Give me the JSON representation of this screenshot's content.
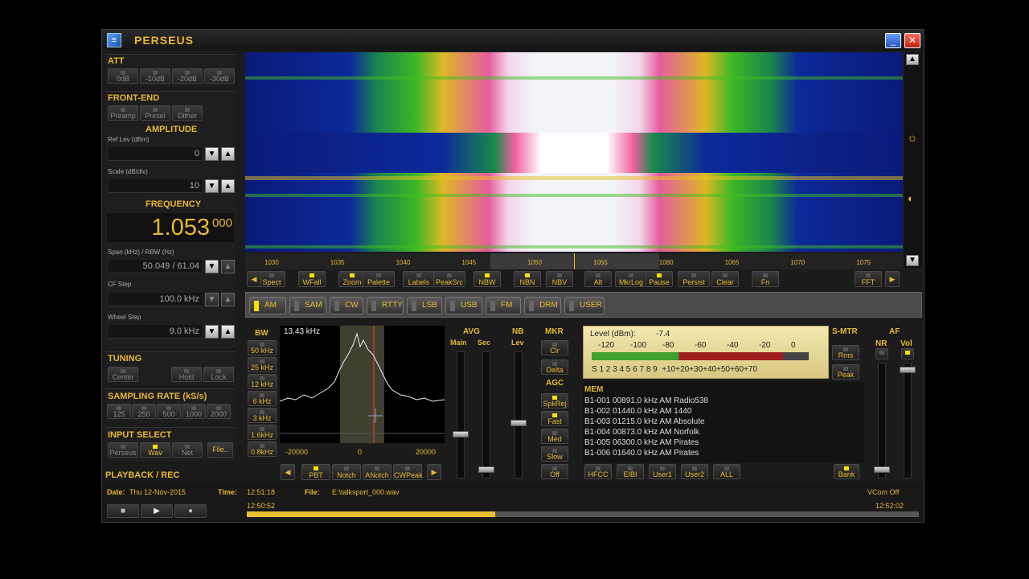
{
  "window": {
    "title": "PERSEUS",
    "minimize_label": "_",
    "close_label": "✕",
    "app_icon": "perseus-icon"
  },
  "att": {
    "title": "ATT",
    "buttons": [
      {
        "label": "0dB",
        "on": false
      },
      {
        "label": "-10dB",
        "on": false
      },
      {
        "label": "-20dB",
        "on": false
      },
      {
        "label": "-30dB",
        "on": false
      }
    ]
  },
  "frontend": {
    "title": "FRONT-END",
    "buttons": [
      {
        "label": "Preamp",
        "on": false
      },
      {
        "label": "Presel",
        "on": false
      },
      {
        "label": "Dither",
        "on": false
      }
    ]
  },
  "amplitude": {
    "title": "AMPLITUDE",
    "ref_label": "Ref Lev (dBm)",
    "ref_value": "0",
    "scale_label": "Scale (dB/div)",
    "scale_value": "10"
  },
  "frequency": {
    "title": "FREQUENCY",
    "main": "1.053",
    "fine": "000",
    "span_label": "Span (kHz) / RBW (Hz)",
    "span_value": "50.049 / 61.04",
    "cfstep_label": "CF Step",
    "cfstep_value": "100.0 kHz",
    "wheel_label": "Wheel Step",
    "wheel_value": "9.0 kHz"
  },
  "tuning": {
    "title": "TUNING",
    "buttons": [
      {
        "label": "Center",
        "on": false
      },
      {
        "label": "Hold",
        "on": false
      },
      {
        "label": "Lock",
        "on": false
      }
    ]
  },
  "sampling": {
    "title": "SAMPLING RATE (kS/s)",
    "buttons": [
      {
        "label": "125",
        "on": false
      },
      {
        "label": "250",
        "on": false
      },
      {
        "label": "500",
        "on": false
      },
      {
        "label": "1000",
        "on": false
      },
      {
        "label": "2000",
        "on": false
      }
    ]
  },
  "input": {
    "title": "INPUT SELECT",
    "buttons": [
      {
        "label": "Perseus",
        "on": false
      },
      {
        "label": "Wav",
        "on": true
      },
      {
        "label": "Net",
        "on": false
      }
    ],
    "file_label": "File.."
  },
  "playback": {
    "title": "PLAYBACK / REC",
    "date_label": "Date:",
    "date_value": "Thu 12-Nov-2015",
    "time_label": "Time:",
    "time_value": "12:51:18",
    "file_label": "File:",
    "file_value": "E:\\talksport_000.wav",
    "vcom": "VCom Off",
    "start_time": "12:50:52",
    "end_time": "12:52:02",
    "progress": 0.37
  },
  "scale_ticks": [
    "1030",
    "1035",
    "1040",
    "1045",
    "1050",
    "1055",
    "1060",
    "1065",
    "1070",
    "1075"
  ],
  "display_buttons": [
    {
      "label": "Spect",
      "on": false
    },
    {
      "label": "WFall",
      "on": true
    },
    {
      "label": "Zoom",
      "on": true
    },
    {
      "label": "Palette",
      "on": false
    },
    {
      "label": "Labels",
      "on": false
    },
    {
      "label": "PeakSrc",
      "on": false
    },
    {
      "label": "NBW",
      "on": true
    },
    {
      "label": "NBN",
      "on": true
    },
    {
      "label": "NBV",
      "on": false
    },
    {
      "label": "Alt",
      "on": false
    },
    {
      "label": "MkrLog",
      "on": false
    },
    {
      "label": "Pause",
      "on": true
    },
    {
      "label": "Persist",
      "on": false
    },
    {
      "label": "Clear",
      "on": false
    },
    {
      "label": "Fn",
      "on": false
    },
    {
      "label": "FFT",
      "on": false
    }
  ],
  "modes": [
    {
      "label": "AM",
      "on": true
    },
    {
      "label": "SAM",
      "on": false
    },
    {
      "label": "CW",
      "on": false
    },
    {
      "label": "RTTY",
      "on": false
    },
    {
      "label": "LSB",
      "on": false
    },
    {
      "label": "USB",
      "on": false
    },
    {
      "label": "FM",
      "on": false
    },
    {
      "label": "DRM",
      "on": false
    },
    {
      "label": "USER",
      "on": false
    }
  ],
  "bw": {
    "title": "BW",
    "buttons": [
      "50 kHz",
      "25 kHz",
      "12 kHz",
      "6 kHz",
      "3 kHz",
      "1.6kHz",
      "0.8kHz"
    ]
  },
  "spectrum": {
    "bw_readout": "13.43 kHz",
    "x_ticks": [
      "-20000",
      "0",
      "20000"
    ]
  },
  "filter_buttons": [
    {
      "label": "PBT",
      "on": true
    },
    {
      "label": "Notch",
      "on": false
    },
    {
      "label": "ANotch",
      "on": false
    },
    {
      "label": "CWPeak",
      "on": false
    }
  ],
  "avg": {
    "title": "AVG",
    "main_label": "Main",
    "sec_label": "Sec"
  },
  "nb": {
    "title": "NB",
    "lev_label": "Lev"
  },
  "mkr": {
    "title": "MKR",
    "buttons": [
      {
        "label": "Clr",
        "on": false
      },
      {
        "label": "Delta",
        "on": false
      }
    ]
  },
  "agc": {
    "title": "AGC",
    "buttons": [
      {
        "label": "SpkRej",
        "on": true
      },
      {
        "label": "Fast",
        "on": true
      },
      {
        "label": "Med",
        "on": false
      },
      {
        "label": "Slow",
        "on": false
      },
      {
        "label": "Off",
        "on": false
      }
    ]
  },
  "meter": {
    "level_label": "Level (dBm):",
    "level_value": "-7.4",
    "dbm_scale": [
      "-120",
      "-100",
      "-80",
      "-60",
      "-40",
      "-20",
      "0"
    ],
    "s_scale": "S 1 2 3 4 5 6 7 8 9  +10+20+30+40+50+60+70",
    "fill": 0.88
  },
  "smtr": {
    "title": "S-MTR",
    "buttons": [
      {
        "label": "Rms",
        "on": false
      },
      {
        "label": "Peak",
        "on": false
      }
    ]
  },
  "af": {
    "title": "AF",
    "nr_label": "NR",
    "vol_label": "Vol"
  },
  "mem": {
    "title": "MEM",
    "rows": [
      "B1-001 00891.0 kHz  AM  Radio538",
      "B1-002 01440.0 kHz  AM  1440",
      "B1-003 01215.0 kHz  AM  Absolute",
      "B1-004 00873.0 kHz  AM  Norfolk",
      "B1-005 06300.0 kHz  AM  Pirates",
      "B1-006 01640.0 kHz  AM  Pirates"
    ],
    "buttons": [
      "HFCC",
      "EIBI",
      "User1",
      "User2",
      "ALL"
    ],
    "bank_label": "Bank"
  },
  "colors": {
    "accent": "#e8b830",
    "led_on": "#ffe000"
  }
}
